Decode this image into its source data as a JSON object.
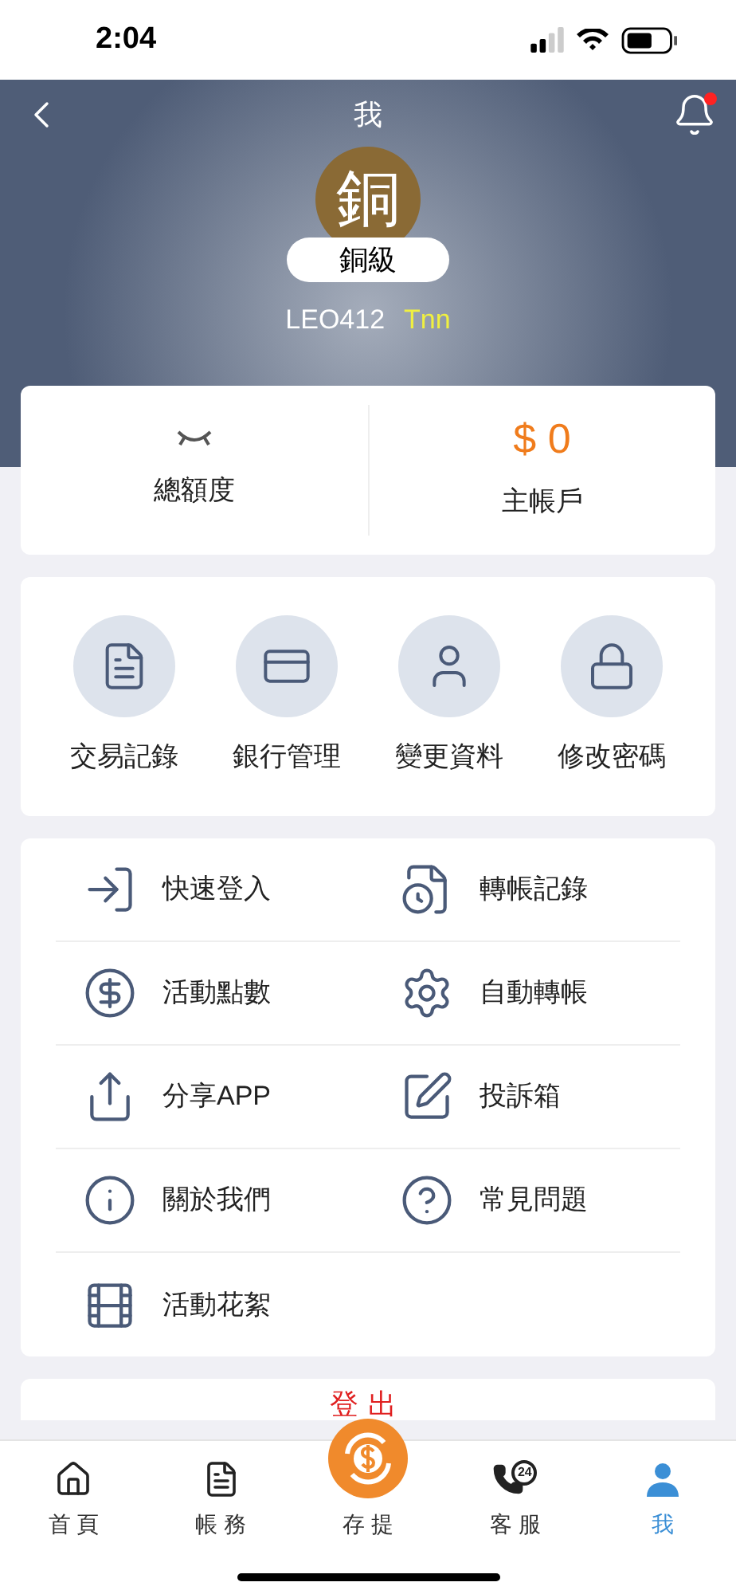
{
  "status_bar": {
    "time": "2:04"
  },
  "header": {
    "title": "我",
    "notification_dot": true
  },
  "profile": {
    "badge_char": "銅",
    "level": "銅級",
    "username": "LEO412",
    "nickname": "Tnn"
  },
  "balance": [
    {
      "kind": "hidden",
      "label": "總額度"
    },
    {
      "kind": "amount",
      "value": "$ 0",
      "label": "主帳戶"
    }
  ],
  "shortcuts": [
    {
      "kind": "records",
      "label": "交易記錄"
    },
    {
      "kind": "bank",
      "label": "銀行管理"
    },
    {
      "kind": "profile",
      "label": "變更資料"
    },
    {
      "kind": "password",
      "label": "修改密碼"
    }
  ],
  "menu": [
    {
      "kind": "login",
      "label": "快速登入"
    },
    {
      "kind": "transfer_log",
      "label": "轉帳記錄"
    },
    {
      "kind": "points",
      "label": "活動點數"
    },
    {
      "kind": "auto",
      "label": "自動轉帳"
    },
    {
      "kind": "share",
      "label": "分享APP"
    },
    {
      "kind": "complaint",
      "label": "投訴箱"
    },
    {
      "kind": "about",
      "label": "關於我們"
    },
    {
      "kind": "faq",
      "label": "常見問題"
    },
    {
      "kind": "video",
      "label": "活動花絮"
    }
  ],
  "logout": {
    "label": "登出"
  },
  "tab_bar": [
    {
      "kind": "home",
      "label": "首 頁",
      "selected": false
    },
    {
      "kind": "bill",
      "label": "帳 務",
      "selected": false
    },
    {
      "kind": "cash",
      "label": "存 提",
      "selected": false
    },
    {
      "kind": "service",
      "label": "客 服",
      "icon_text": "24",
      "selected": false
    },
    {
      "kind": "me",
      "label": "我",
      "selected": true
    }
  ]
}
